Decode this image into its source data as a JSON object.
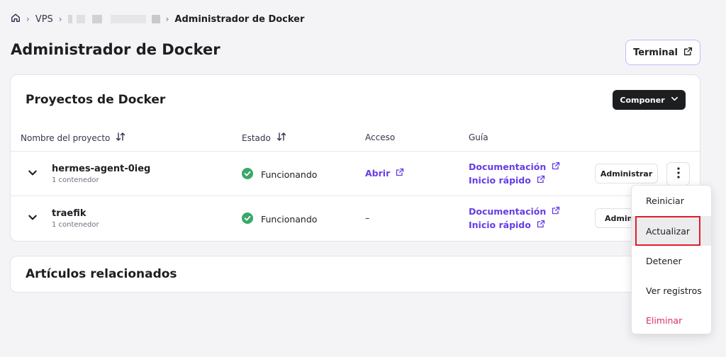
{
  "breadcrumb": {
    "items": [
      "VPS"
    ],
    "current": "Administrador de Docker"
  },
  "page": {
    "title": "Administrador de Docker",
    "terminal_label": "Terminal"
  },
  "projects": {
    "title": "Proyectos de Docker",
    "compose_label": "Componer",
    "columns": {
      "name": "Nombre del proyecto",
      "status": "Estado",
      "access": "Acceso",
      "guide": "Guía"
    },
    "rows": [
      {
        "name": "hermes-agent-0ieg",
        "subtitle": "1 contenedor",
        "status": "Funcionando",
        "access": "Abrir",
        "docs": "Documentación",
        "quickstart": "Inicio rápido",
        "manage": "Administrar"
      },
      {
        "name": "traefik",
        "subtitle": "1 contenedor",
        "status": "Funcionando",
        "access": "–",
        "docs": "Documentación",
        "quickstart": "Inicio rápido",
        "manage": "Administrar"
      }
    ]
  },
  "articles": {
    "title": "Artículos relacionados"
  },
  "context_menu": {
    "items": [
      "Reiniciar",
      "Actualizar",
      "Detener",
      "Ver registros",
      "Eliminar"
    ],
    "highlighted": "Actualizar"
  },
  "colors": {
    "accent": "#673de6",
    "success": "#00b090",
    "danger": "#d63163",
    "highlight_border": "#e11d2a"
  }
}
